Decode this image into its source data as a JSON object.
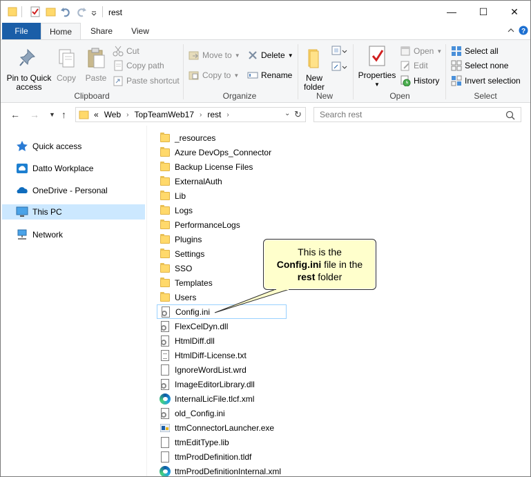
{
  "window": {
    "title": "rest",
    "controls": {
      "minimize": "—",
      "maximize": "☐",
      "close": "✕"
    }
  },
  "ribbon_tabs": [
    {
      "label": "File"
    },
    {
      "label": "Home"
    },
    {
      "label": "Share"
    },
    {
      "label": "View"
    }
  ],
  "ribbon": {
    "clipboard": {
      "label": "Clipboard",
      "pin_line1": "Pin to Quick",
      "pin_line2": "access",
      "copy": "Copy",
      "paste": "Paste",
      "cut": "Cut",
      "copy_path": "Copy path",
      "paste_shortcut": "Paste shortcut"
    },
    "organize": {
      "label": "Organize",
      "move_to": "Move to",
      "copy_to": "Copy to",
      "delete": "Delete",
      "rename": "Rename"
    },
    "new": {
      "label": "New",
      "new_folder_line1": "New",
      "new_folder_line2": "folder"
    },
    "open": {
      "label": "Open",
      "properties": "Properties",
      "open": "Open",
      "edit": "Edit",
      "history": "History"
    },
    "select": {
      "label": "Select",
      "select_all": "Select all",
      "select_none": "Select none",
      "invert_selection": "Invert selection"
    }
  },
  "address": {
    "prefix": "«",
    "crumbs": [
      "Web",
      "TopTeamWeb17",
      "rest"
    ],
    "search_placeholder": "Search rest"
  },
  "nav_pane": [
    {
      "label": "Quick access",
      "icon": "star-icon"
    },
    {
      "label": "Datto Workplace",
      "icon": "cloud-icon"
    },
    {
      "label": "OneDrive - Personal",
      "icon": "onedrive-icon"
    },
    {
      "label": "This PC",
      "icon": "computer-icon",
      "selected": true
    },
    {
      "label": "Network",
      "icon": "network-icon"
    }
  ],
  "files": [
    {
      "name": "_resources",
      "type": "folder"
    },
    {
      "name": "Azure DevOps_Connector",
      "type": "folder"
    },
    {
      "name": "Backup License Files",
      "type": "folder"
    },
    {
      "name": "ExternalAuth",
      "type": "folder"
    },
    {
      "name": "Lib",
      "type": "folder"
    },
    {
      "name": "Logs",
      "type": "folder"
    },
    {
      "name": "PerformanceLogs",
      "type": "folder"
    },
    {
      "name": "Plugins",
      "type": "folder"
    },
    {
      "name": "Settings",
      "type": "folder"
    },
    {
      "name": "SSO",
      "type": "folder"
    },
    {
      "name": "Templates",
      "type": "folder"
    },
    {
      "name": "Users",
      "type": "folder"
    },
    {
      "name": "Config.ini",
      "type": "config",
      "focused": true
    },
    {
      "name": "FlexCelDyn.dll",
      "type": "config"
    },
    {
      "name": "HtmlDiff.dll",
      "type": "config"
    },
    {
      "name": "HtmlDiff-License.txt",
      "type": "text"
    },
    {
      "name": "IgnoreWordList.wrd",
      "type": "doc"
    },
    {
      "name": "ImageEditorLibrary.dll",
      "type": "config"
    },
    {
      "name": "InternalLicFile.tlcf.xml",
      "type": "edge"
    },
    {
      "name": "old_Config.ini",
      "type": "config"
    },
    {
      "name": "ttmConnectorLauncher.exe",
      "type": "exe"
    },
    {
      "name": "ttmEditType.lib",
      "type": "doc"
    },
    {
      "name": "ttmProdDefinition.tldf",
      "type": "doc"
    },
    {
      "name": "ttmProdDefinitionInternal.xml",
      "type": "edge"
    }
  ],
  "callout": {
    "line1": "This is the",
    "line2_bold": "Config.ini",
    "line2_rest": " file in the",
    "line3_bold": "rest",
    "line3_rest": " folder"
  },
  "colors": {
    "file_tab": "#1a5ea8",
    "selection": "#cce8ff",
    "callout_fill": "#ffffcc",
    "folder": "#ffd96b"
  }
}
